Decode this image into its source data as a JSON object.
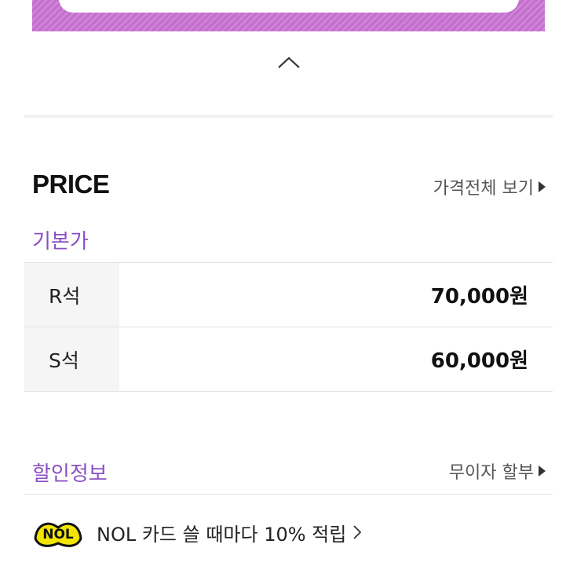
{
  "price_section": {
    "title": "PRICE",
    "view_all_label": "가격전체 보기",
    "base_price_label": "기본가",
    "rows": [
      {
        "seat": "R석",
        "price": "70,000원"
      },
      {
        "seat": "S석",
        "price": "60,000원"
      }
    ]
  },
  "discount_section": {
    "title": "할인정보",
    "installment_label": "무이자 할부",
    "promo": {
      "logo_text": "NOL",
      "text": "NOL 카드 쓸 때마다 10% 적립"
    }
  },
  "colors": {
    "banner": "#c56fcf",
    "accent_purple": "#8a4fc4",
    "logo_yellow": "#f2e600"
  },
  "icons": [
    "chevron-up-icon",
    "triangle-right-icon",
    "nol-logo",
    "chevron-right-icon"
  ]
}
